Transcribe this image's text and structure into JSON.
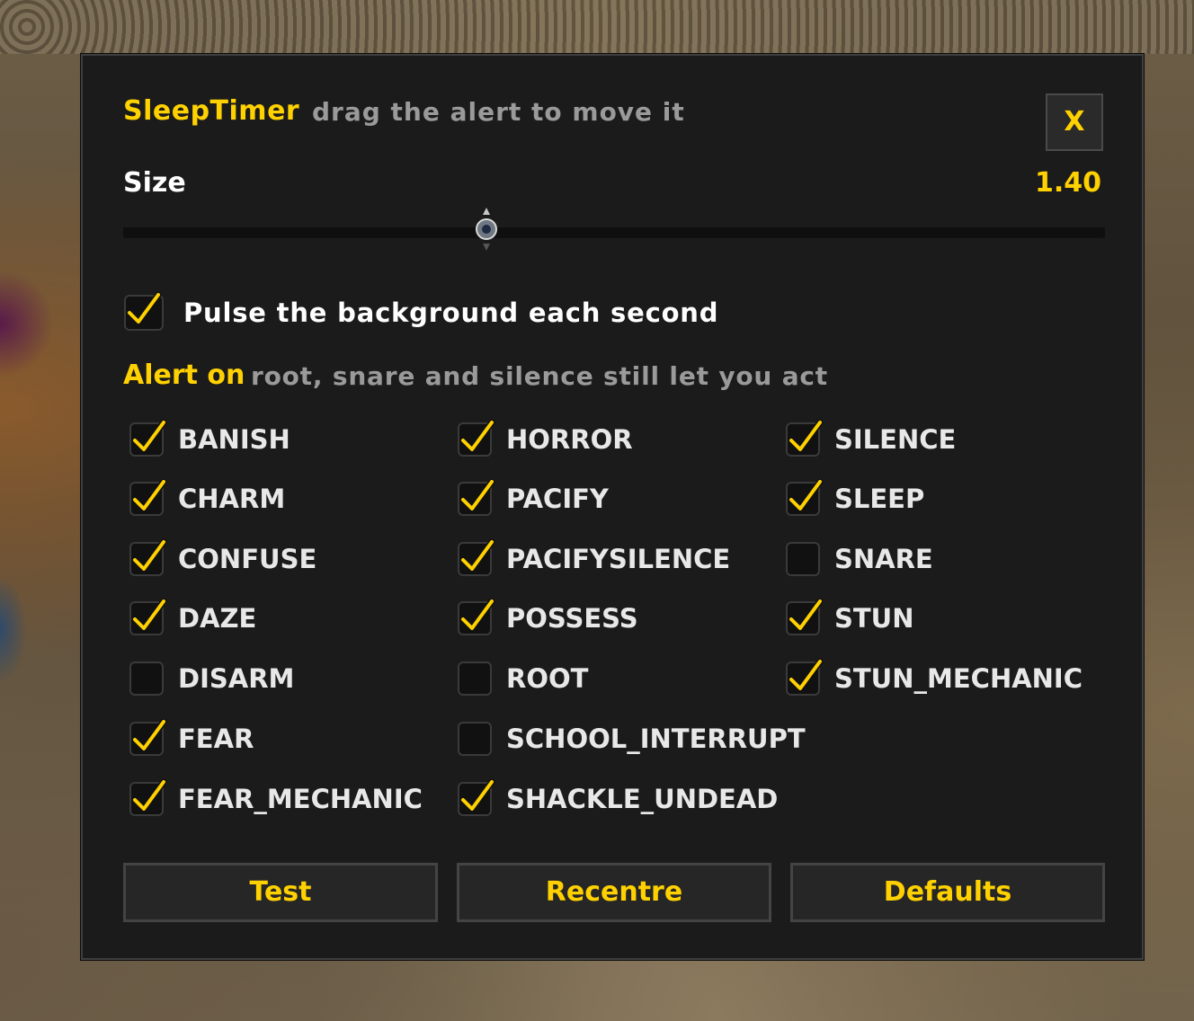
{
  "header": {
    "title": "SleepTimer",
    "hint": "drag the alert to move it",
    "close_label": "X"
  },
  "size": {
    "label": "Size",
    "value": "1.40",
    "slider_fraction": 0.37
  },
  "pulse": {
    "label": "Pulse the background each second",
    "checked": true
  },
  "alert": {
    "title": "Alert on",
    "hint": "root, snare and silence still let you act"
  },
  "options": {
    "col1": [
      {
        "label": "BANISH",
        "checked": true
      },
      {
        "label": "CHARM",
        "checked": true
      },
      {
        "label": "CONFUSE",
        "checked": true
      },
      {
        "label": "DAZE",
        "checked": true
      },
      {
        "label": "DISARM",
        "checked": false
      },
      {
        "label": "FEAR",
        "checked": true
      },
      {
        "label": "FEAR_MECHANIC",
        "checked": true
      }
    ],
    "col2": [
      {
        "label": "HORROR",
        "checked": true
      },
      {
        "label": "PACIFY",
        "checked": true
      },
      {
        "label": "PACIFYSILENCE",
        "checked": true
      },
      {
        "label": "POSSESS",
        "checked": true
      },
      {
        "label": "ROOT",
        "checked": false
      },
      {
        "label": "SCHOOL_INTERRUPT",
        "checked": false
      },
      {
        "label": "SHACKLE_UNDEAD",
        "checked": true
      }
    ],
    "col3": [
      {
        "label": "SILENCE",
        "checked": true
      },
      {
        "label": "SLEEP",
        "checked": true
      },
      {
        "label": "SNARE",
        "checked": false
      },
      {
        "label": "STUN",
        "checked": true
      },
      {
        "label": "STUN_MECHANIC",
        "checked": true
      }
    ]
  },
  "buttons": {
    "test": "Test",
    "recentre": "Recentre",
    "defaults": "Defaults"
  },
  "colors": {
    "accent": "#ffd100",
    "panel": "#1b1b1b",
    "hint": "#9a9a9a"
  }
}
